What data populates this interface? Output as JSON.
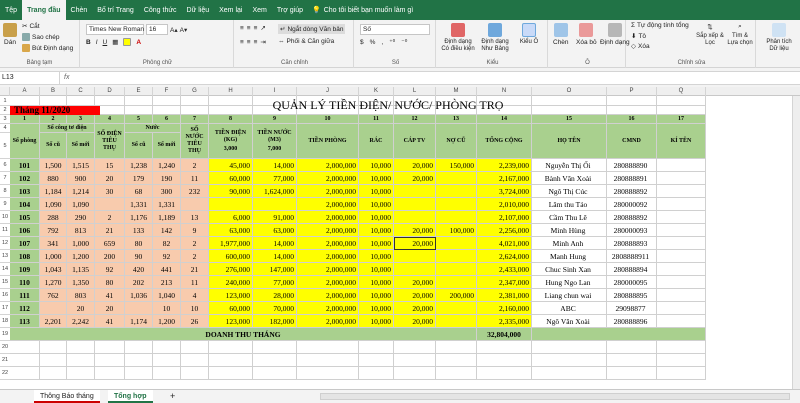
{
  "menu": {
    "tabs": [
      "Tệp",
      "Trang đầu",
      "Chèn",
      "Bố trí Trang",
      "Công thức",
      "Dữ liệu",
      "Xem lại",
      "Xem",
      "Trợ giúp"
    ],
    "active": "Trang đầu",
    "tellme": "Cho tôi biết bạn muốn làm gì"
  },
  "ribbon": {
    "clipboard": {
      "paste": "Dán",
      "cut": "Cắt",
      "copy": "Sao chép",
      "format_painter": "Bút Định dạng",
      "label": "Bảng tạm"
    },
    "font": {
      "name": "Times New Roman",
      "size": "16",
      "bold": "B",
      "italic": "I",
      "underline": "U",
      "label": "Phông chữ"
    },
    "alignment": {
      "wrap": "Ngắt dòng Văn bản",
      "merge": "Phối & Căn giữa",
      "label": "Căn chỉnh"
    },
    "number": {
      "format": "Số",
      "currency": "$",
      "percent": "%",
      "comma": ",",
      "label": "Số"
    },
    "styles": {
      "conditional": "Định dạng Có điều kiện",
      "table": "Định dạng Như Bảng",
      "cell_styles": "Kiểu Ô",
      "label": "Kiểu"
    },
    "cells": {
      "insert": "Chèn",
      "delete": "Xóa bỏ",
      "format": "Định dạng",
      "label": "Ô"
    },
    "editing": {
      "autosum": "Tự động tính tổng",
      "fill": "Tô",
      "clear": "Xóa",
      "sort": "Sắp xếp & Lọc",
      "find": "Tìm & Lựa chọn",
      "label": "Chỉnh sửa"
    },
    "analysis": {
      "analyze": "Phân tích Dữ liệu",
      "label": "Phân tích Dữ liệu"
    }
  },
  "formula": {
    "namebox": "L13",
    "fx": "fx"
  },
  "sheet": {
    "columns": [
      "A",
      "B",
      "C",
      "D",
      "E",
      "F",
      "G",
      "H",
      "I",
      "J",
      "K",
      "L",
      "M",
      "N",
      "O",
      "P",
      "Q"
    ],
    "rows": [
      "1",
      "2",
      "3",
      "4",
      "5",
      "6",
      "7",
      "8",
      "9",
      "10",
      "11",
      "12",
      "13",
      "14",
      "15",
      "16",
      "17",
      "18",
      "19",
      "20",
      "21",
      "22"
    ],
    "title": "QUẢN LÝ TIỀN ĐIỆN/ NƯỚC/ PHÒNG TRỌ",
    "month": "Tháng 11/2020",
    "col_numbers": [
      "1",
      "2",
      "3",
      "4",
      "5",
      "6",
      "7",
      "8",
      "9",
      "10",
      "11",
      "12",
      "13",
      "14",
      "15",
      "16",
      "17"
    ],
    "headers": {
      "so_phong": "Số phòng",
      "cong_to_dien": "Số công tơ điện",
      "so_cu": "Số cũ",
      "so_moi": "Số mới",
      "so_dien_tieu_thu": "SỐ ĐIỆN TIÊU THỤ",
      "nuoc": "Nước",
      "nuoc_so_cu": "Số cũ",
      "nuoc_so_moi": "Số mới",
      "so_nuoc_tieu_thu": "SỐ NƯỚC TIÊU THỤ",
      "tien_dien": "TIỀN ĐIỆN (KG)",
      "tien_dien_rate": "3,000",
      "tien_nuoc": "TIỀN NƯỚC (M3)",
      "tien_nuoc_rate": "7,000",
      "tien_phong": "TIỀN PHÒNG",
      "rac": "RÁC",
      "cap_tv": "CÁP TV",
      "no_cu": "NỢ CŨ",
      "tong_cong": "TỔNG CỘNG",
      "ho_ten": "HỌ TÊN",
      "cmnd": "CMND",
      "ki_ten": "KÍ TÊN"
    },
    "data": [
      [
        "101",
        "1,500",
        "1,515",
        "15",
        "1,238",
        "1,240",
        "2",
        "45,000",
        "14,000",
        "2,000,000",
        "10,000",
        "20,000",
        "150,000",
        "2,239,000",
        "Nguyễn Thị Ổi",
        "280888890",
        ""
      ],
      [
        "102",
        "880",
        "900",
        "20",
        "179",
        "190",
        "11",
        "60,000",
        "77,000",
        "2,000,000",
        "10,000",
        "20,000",
        "",
        "2,167,000",
        "Bành Văn Xoài",
        "280888891",
        ""
      ],
      [
        "103",
        "1,184",
        "1,214",
        "30",
        "68",
        "300",
        "232",
        "90,000",
        "1,624,000",
        "2,000,000",
        "10,000",
        "",
        "",
        "3,724,000",
        "Ngô Thị Cúc",
        "280888892",
        ""
      ],
      [
        "104",
        "1,090",
        "1,090",
        "",
        "1,331",
        "1,331",
        "",
        "",
        "",
        "2,000,000",
        "10,000",
        "",
        "",
        "2,010,000",
        "Lâm thu Táo",
        "280000092",
        ""
      ],
      [
        "105",
        "288",
        "290",
        "2",
        "1,176",
        "1,189",
        "13",
        "6,000",
        "91,000",
        "2,000,000",
        "10,000",
        "",
        "",
        "2,107,000",
        "Cầm Thu Lê",
        "280888892",
        ""
      ],
      [
        "106",
        "792",
        "813",
        "21",
        "133",
        "142",
        "9",
        "63,000",
        "63,000",
        "2,000,000",
        "10,000",
        "20,000",
        "100,000",
        "2,256,000",
        "Minh Hùng",
        "280000093",
        ""
      ],
      [
        "107",
        "341",
        "1,000",
        "659",
        "80",
        "82",
        "2",
        "1,977,000",
        "14,000",
        "2,000,000",
        "10,000",
        "20,000",
        "",
        "4,021,000",
        "Minh Anh",
        "280888893",
        ""
      ],
      [
        "108",
        "1,000",
        "1,200",
        "200",
        "90",
        "92",
        "2",
        "600,000",
        "14,000",
        "2,000,000",
        "10,000",
        "",
        "",
        "2,624,000",
        "Manh Hung",
        "2808888911",
        ""
      ],
      [
        "109",
        "1,043",
        "1,135",
        "92",
        "420",
        "441",
        "21",
        "276,000",
        "147,000",
        "2,000,000",
        "10,000",
        "",
        "",
        "2,433,000",
        "Chuc Sinh Xan",
        "280888894",
        ""
      ],
      [
        "110",
        "1,270",
        "1,350",
        "80",
        "202",
        "213",
        "11",
        "240,000",
        "77,000",
        "2,000,000",
        "10,000",
        "20,000",
        "",
        "2,347,000",
        "Hung Ngo Lan",
        "280000095",
        ""
      ],
      [
        "111",
        "762",
        "803",
        "41",
        "1,036",
        "1,040",
        "4",
        "123,000",
        "28,000",
        "2,000,000",
        "10,000",
        "20,000",
        "200,000",
        "2,381,000",
        "Liang chun wai",
        "280888895",
        ""
      ],
      [
        "112",
        "",
        "20",
        "20",
        "",
        "10",
        "10",
        "60,000",
        "70,000",
        "2,000,000",
        "10,000",
        "20,000",
        "",
        "2,160,000",
        "ABC",
        "29098877",
        ""
      ],
      [
        "113",
        "2,201",
        "2,242",
        "41",
        "1,174",
        "1,200",
        "26",
        "123,000",
        "182,000",
        "2,000,000",
        "10,000",
        "20,000",
        "",
        "2,335,000",
        "Ngô Văn Xoài",
        "280888896",
        ""
      ]
    ],
    "total_label": "DOANH THU THÁNG",
    "total_value": "32,804,000"
  },
  "tabs": {
    "sheet1": "Thông Báo tháng",
    "sheet2": "Tổng hợp",
    "add": "+"
  },
  "colors": {
    "brand": "#217346",
    "header_green": "#a9d08e",
    "yellow": "#ffff00",
    "orange": "#f8cbad",
    "red": "#ff0000"
  }
}
